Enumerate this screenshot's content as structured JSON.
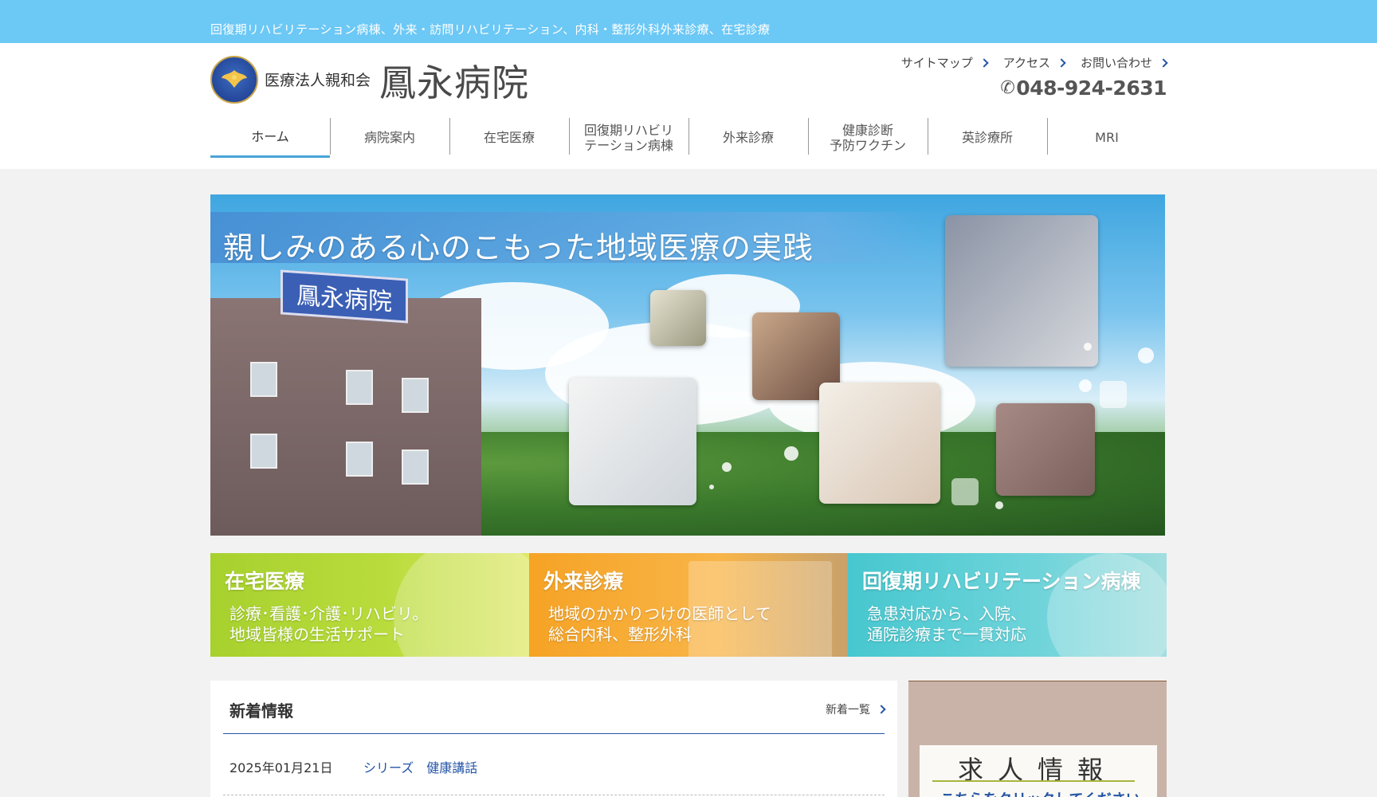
{
  "topbar": {
    "tagline": "回復期リハビリテーション病棟、外来・訪問リハビリテーション、内科・整形外科外来診療、在宅診療"
  },
  "header": {
    "org_name": "医療法人親和会",
    "hospital_name": "鳳永病院",
    "util_links": [
      {
        "label": "サイトマップ"
      },
      {
        "label": "アクセス"
      },
      {
        "label": "お問い合わせ"
      }
    ],
    "phone": "048-924-2631"
  },
  "nav": {
    "items": [
      {
        "label": "ホーム",
        "active": true
      },
      {
        "label": "病院案内"
      },
      {
        "label": "在宅医療"
      },
      {
        "label": "回復期リハビリ\nテーション病棟"
      },
      {
        "label": "外来診療"
      },
      {
        "label": "健康診断\n予防ワクチン"
      },
      {
        "label": "英診療所"
      },
      {
        "label": "MRI"
      }
    ]
  },
  "hero": {
    "headline": "親しみのある心のこもった地域医療の実践",
    "building_sign": "鳳永病院"
  },
  "banners": [
    {
      "title": "在宅医療",
      "line1": "診療･看護･介護･リハビリ。",
      "line2": "地域皆様の生活サポート",
      "color": "#a7d12e"
    },
    {
      "title": "外来診療",
      "line1": "地域のかかりつけの医師として",
      "line2": "総合内科、整形外科",
      "color": "#f6a325"
    },
    {
      "title": "回復期リハビリテーション病棟",
      "line1": "急患対応から、入院、",
      "line2": "通院診療まで一貫対応",
      "color": "#47c7cf"
    }
  ],
  "news": {
    "title": "新着情報",
    "more_label": "新着一覧",
    "items": [
      {
        "date": "2025年01月21日",
        "text": "シリーズ　健康講話"
      }
    ]
  },
  "recruit": {
    "title": "求人情報",
    "subtitle": "こちらをクリックしてください"
  },
  "colors": {
    "topbar": "#6cc8f5",
    "accent": "#2455a6",
    "nav_active": "#4aa5d8"
  }
}
